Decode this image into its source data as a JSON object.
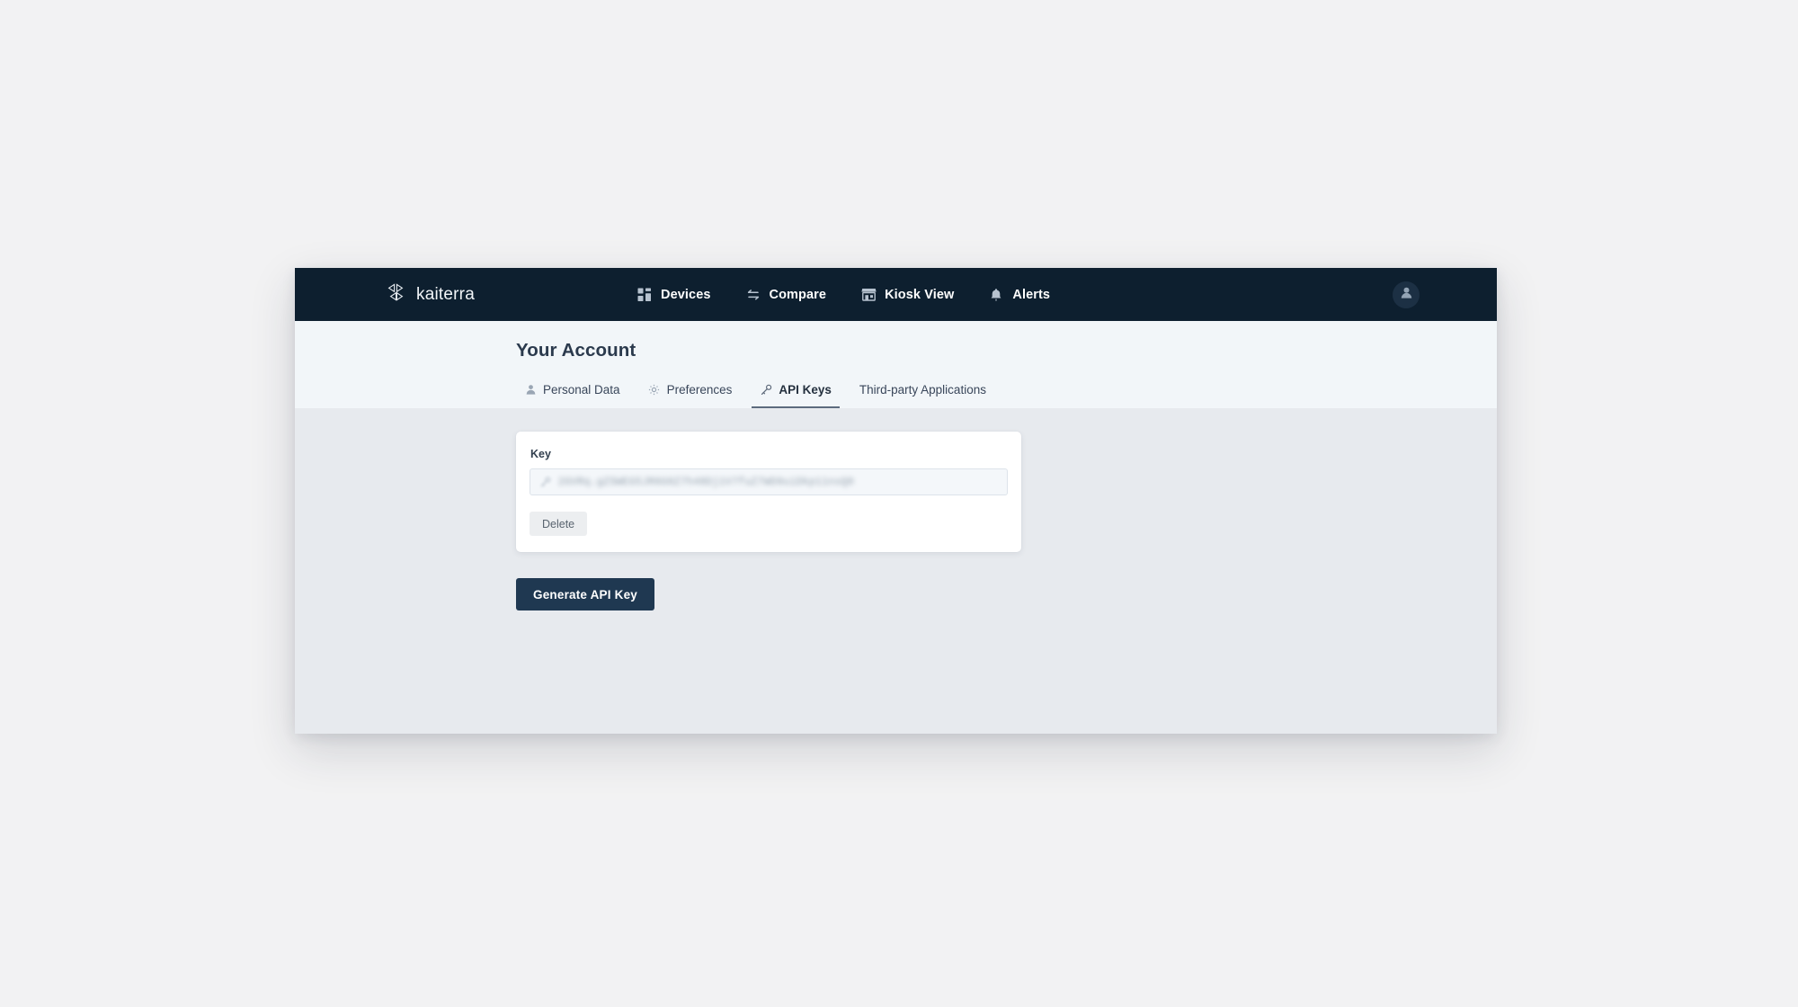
{
  "navbar": {
    "brand": {
      "name": "kaiterra",
      "icon": "kaiterra-logo-icon"
    },
    "links": [
      {
        "label": "Devices",
        "icon": "grid-icon"
      },
      {
        "label": "Compare",
        "icon": "compare-arrows-icon"
      },
      {
        "label": "Kiosk View",
        "icon": "storefront-icon"
      },
      {
        "label": "Alerts",
        "icon": "bell-icon"
      }
    ],
    "avatar_icon": "user-avatar-icon",
    "background_color": "#0d1f2f"
  },
  "header": {
    "title": "Your Account",
    "tabs": [
      {
        "label": "Personal Data",
        "icon": "person-icon",
        "active": false
      },
      {
        "label": "Preferences",
        "icon": "gear-icon",
        "active": false
      },
      {
        "label": "API Keys",
        "icon": "key-icon",
        "active": true
      },
      {
        "label": "Third-party Applications",
        "icon": "",
        "active": false
      }
    ],
    "background_color": "#f2f6f9"
  },
  "main": {
    "key_card": {
      "field_label": "Key",
      "key_icon": "key-icon",
      "key_value": "2GVRq.gZSWEG5JR6G0Z7h48Dj1V7fuZ7WD9uiDkp11nsQ0",
      "key_value_redacted": true,
      "delete_label": "Delete"
    },
    "generate_label": "Generate API Key",
    "generate_color": "#1f3851",
    "background_color": "#e7eaee"
  }
}
